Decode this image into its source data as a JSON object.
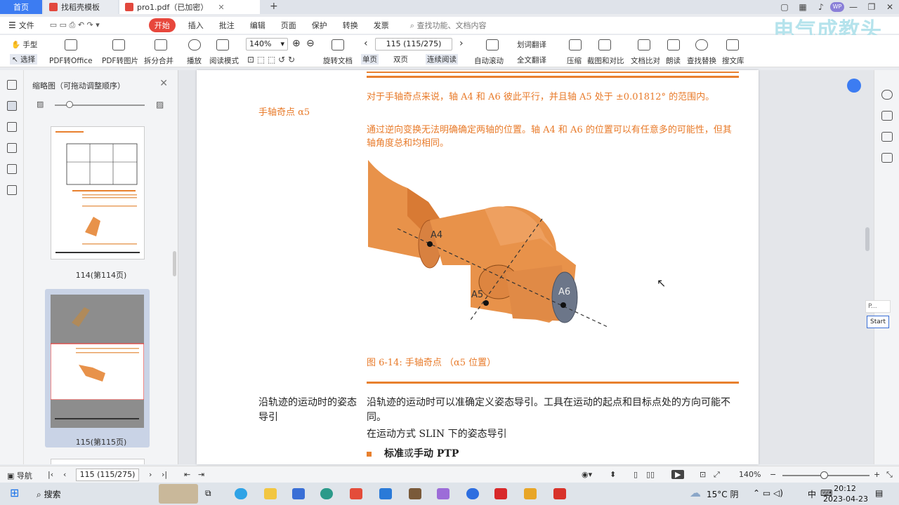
{
  "tabs": {
    "home": "首页",
    "templates": "找稻壳模板",
    "pdf": "pro1.pdf（已加密）"
  },
  "menu": {
    "file": "文件",
    "start": "开始",
    "items": [
      "插入",
      "批注",
      "编辑",
      "页面",
      "保护",
      "转换",
      "发票"
    ],
    "search_placeholder": "查找功能、文档内容"
  },
  "watermark": "电气成教头",
  "toolbar": {
    "hand": "手型",
    "select": "选择",
    "to_office": "PDF转Office",
    "to_image": "PDF转图片",
    "split_merge": "拆分合并",
    "play": "播放",
    "read_mode": "阅读模式",
    "zoom": "140%",
    "rotate": "旋转文档",
    "page": "115 (115/275)",
    "single": "单页",
    "double": "双页",
    "continuous": "连续阅读",
    "autoscroll": "自动滚动",
    "word_translate": "划词翻译",
    "full_translate": "全文翻译",
    "compress": "压缩",
    "crop": "截图和对比",
    "compare": "文档比对",
    "read_aloud": "朗读",
    "find_replace": "查找替换",
    "search_lib": "搜文库"
  },
  "thumbpanel": {
    "title": "缩略图（可拖动调整顺序）",
    "page114": "114(第114页)",
    "page115": "115(第115页)"
  },
  "document": {
    "label_wrist": "手轴奇点  α5",
    "para1": "对于手轴奇点来说，轴 A4 和 A6 彼此平行，并且轴 A5 处于 ±0.01812° 的范围内。",
    "para2": "通过逆向变换无法明确确定两轴的位置。轴 A4 和 A6 的位置可以有任意多的可能性，但其轴角度总和均相同。",
    "axis_a4": "A4",
    "axis_a5": "A5",
    "axis_a6": "A6",
    "caption": "图   6-14: 手轴奇点 （α5 位置）",
    "label_orient": "沿轨迹的运动时的姿态导引",
    "para3": "沿轨迹的运动时可以准确定义姿态导引。工具在运动的起点和目标点处的方向可能不同。",
    "para4": "在运动方式 SLIN 下的姿态导引",
    "bullet_bold1": "标准",
    "bullet_mid": "或",
    "bullet_bold2": "手动 PTP",
    "colors": {
      "accent": "#e8802e",
      "text_orange": "#e87a29"
    }
  },
  "side_widget": {
    "top": "P...",
    "button": "Start"
  },
  "statusbar": {
    "nav": "导航",
    "page": "115 (115/275)",
    "zoom": "140%"
  },
  "taskbar": {
    "search": "搜索",
    "weather": "15°C 阴",
    "ime": "中",
    "time": "20:12",
    "date": "2023-04-23"
  }
}
